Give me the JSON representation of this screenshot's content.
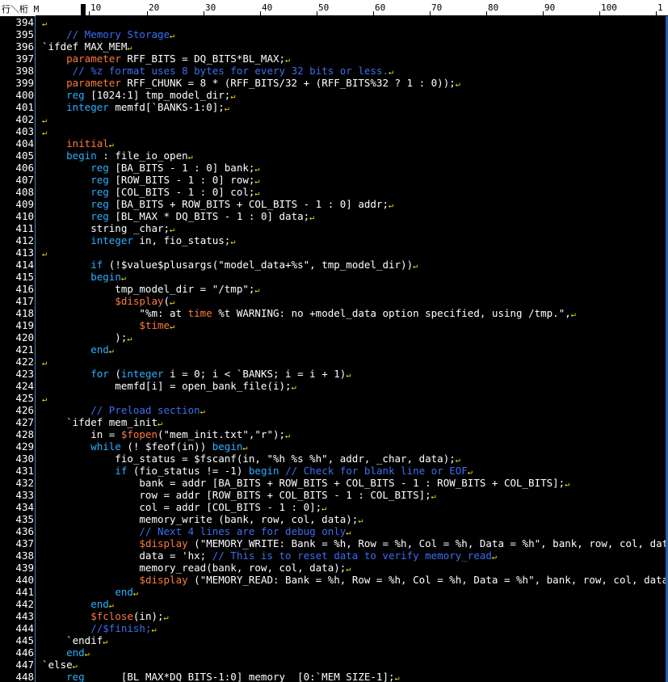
{
  "ruler": {
    "corner_label": "行＼桁 M",
    "marks": [
      "10",
      "20",
      "30",
      "40",
      "50",
      "60",
      "70",
      "80",
      "90",
      "100",
      "1"
    ]
  },
  "eol_glyph": "↵",
  "colors": {
    "keyword": "#2ab0ff",
    "system": "#ff7a3c",
    "comment": "#3a6ff0",
    "text": "#ffffff",
    "eol": "#ffe100"
  },
  "lines": [
    {
      "n": "394",
      "t": []
    },
    {
      "n": "395",
      "t": [
        [
          "    ",
          ""
        ],
        [
          "// Memory Storage",
          "cm"
        ]
      ]
    },
    {
      "n": "396",
      "t": [
        [
          "`ifdef MAX_MEM",
          ""
        ]
      ]
    },
    {
      "n": "397",
      "t": [
        [
          "    ",
          ""
        ],
        [
          "parameter",
          "pk"
        ],
        [
          " RFF_BITS = DQ_BITS*BL_MAX;",
          ""
        ]
      ]
    },
    {
      "n": "398",
      "t": [
        [
          "     ",
          ""
        ],
        [
          "// %z format uses 8 bytes for every 32 bits or less.",
          "cm"
        ]
      ]
    },
    {
      "n": "399",
      "t": [
        [
          "    ",
          ""
        ],
        [
          "parameter",
          "pk"
        ],
        [
          " RFF_CHUNK = 8 * (RFF_BITS/32 + (RFF_BITS%32 ? 1 : 0));",
          ""
        ]
      ]
    },
    {
      "n": "400",
      "t": [
        [
          "    ",
          ""
        ],
        [
          "reg",
          "kw"
        ],
        [
          " [1024:1] tmp_model_dir;",
          ""
        ]
      ]
    },
    {
      "n": "401",
      "t": [
        [
          "    ",
          ""
        ],
        [
          "integer",
          "kw"
        ],
        [
          " memfd[`BANKS-1:0];",
          ""
        ]
      ]
    },
    {
      "n": "402",
      "t": []
    },
    {
      "n": "403",
      "t": []
    },
    {
      "n": "404",
      "t": [
        [
          "    ",
          ""
        ],
        [
          "initial",
          "pk"
        ]
      ]
    },
    {
      "n": "405",
      "t": [
        [
          "    ",
          ""
        ],
        [
          "begin",
          "kw"
        ],
        [
          " : file_io_open",
          ""
        ]
      ]
    },
    {
      "n": "406",
      "t": [
        [
          "        ",
          ""
        ],
        [
          "reg",
          "kw"
        ],
        [
          " [BA_BITS - 1 : 0] bank;",
          ""
        ]
      ]
    },
    {
      "n": "407",
      "t": [
        [
          "        ",
          ""
        ],
        [
          "reg",
          "kw"
        ],
        [
          " [ROW_BITS - 1 : 0] row;",
          ""
        ]
      ]
    },
    {
      "n": "408",
      "t": [
        [
          "        ",
          ""
        ],
        [
          "reg",
          "kw"
        ],
        [
          " [COL_BITS - 1 : 0] col;",
          ""
        ]
      ]
    },
    {
      "n": "409",
      "t": [
        [
          "        ",
          ""
        ],
        [
          "reg",
          "kw"
        ],
        [
          " [BA_BITS + ROW_BITS + COL_BITS - 1 : 0] addr;",
          ""
        ]
      ]
    },
    {
      "n": "410",
      "t": [
        [
          "        ",
          ""
        ],
        [
          "reg",
          "kw"
        ],
        [
          " [BL_MAX * DQ_BITS - 1 : 0] data;",
          ""
        ]
      ]
    },
    {
      "n": "411",
      "t": [
        [
          "        string _char;",
          ""
        ]
      ]
    },
    {
      "n": "412",
      "t": [
        [
          "        ",
          ""
        ],
        [
          "integer",
          "kw"
        ],
        [
          " in, fio_status;",
          ""
        ]
      ]
    },
    {
      "n": "413",
      "t": []
    },
    {
      "n": "414",
      "t": [
        [
          "        ",
          ""
        ],
        [
          "if",
          "kw"
        ],
        [
          " (!$value$plusargs(\"model_data+%s\", tmp_model_dir))",
          ""
        ]
      ]
    },
    {
      "n": "415",
      "t": [
        [
          "        ",
          ""
        ],
        [
          "begin",
          "kw"
        ]
      ]
    },
    {
      "n": "416",
      "t": [
        [
          "            tmp_model_dir = \"/tmp\";",
          ""
        ]
      ]
    },
    {
      "n": "417",
      "t": [
        [
          "            ",
          ""
        ],
        [
          "$display",
          "pk"
        ],
        [
          "(",
          ""
        ]
      ]
    },
    {
      "n": "418",
      "t": [
        [
          "                \"%m: at ",
          ""
        ],
        [
          "time",
          "pk"
        ],
        [
          " %t WARNING: no +model_data option specified, using /tmp.\",",
          ""
        ]
      ]
    },
    {
      "n": "419",
      "t": [
        [
          "                ",
          ""
        ],
        [
          "$time",
          "pk"
        ]
      ]
    },
    {
      "n": "420",
      "t": [
        [
          "            );",
          ""
        ]
      ]
    },
    {
      "n": "421",
      "t": [
        [
          "        ",
          ""
        ],
        [
          "end",
          "kw"
        ]
      ]
    },
    {
      "n": "422",
      "t": []
    },
    {
      "n": "423",
      "t": [
        [
          "        ",
          ""
        ],
        [
          "for",
          "kw"
        ],
        [
          " (",
          ""
        ],
        [
          "integer",
          "kw"
        ],
        [
          " i = 0; i < `BANKS; i = i + 1)",
          ""
        ]
      ]
    },
    {
      "n": "424",
      "t": [
        [
          "            memfd[i] = open_bank_file(i);",
          ""
        ]
      ]
    },
    {
      "n": "425",
      "t": []
    },
    {
      "n": "426",
      "t": [
        [
          "        ",
          ""
        ],
        [
          "// Preload section",
          "cm"
        ]
      ]
    },
    {
      "n": "427",
      "t": [
        [
          "    `ifdef mem_init",
          ""
        ]
      ]
    },
    {
      "n": "428",
      "t": [
        [
          "        in = ",
          ""
        ],
        [
          "$fopen",
          "pk"
        ],
        [
          "(\"mem_init.txt\",\"r\");",
          ""
        ]
      ]
    },
    {
      "n": "429",
      "t": [
        [
          "        ",
          ""
        ],
        [
          "while",
          "kw"
        ],
        [
          " (! $feof(in)) ",
          ""
        ],
        [
          "begin",
          "kw"
        ]
      ]
    },
    {
      "n": "430",
      "t": [
        [
          "            fio_status = $fscanf(in, \"%h %s %h\", addr, _char, data);",
          ""
        ]
      ]
    },
    {
      "n": "431",
      "t": [
        [
          "            ",
          ""
        ],
        [
          "if",
          "kw"
        ],
        [
          " (fio_status != -1) ",
          ""
        ],
        [
          "begin",
          "kw"
        ],
        [
          " ",
          ""
        ],
        [
          "// Check for blank line or EOF",
          "cm"
        ]
      ]
    },
    {
      "n": "432",
      "t": [
        [
          "                bank = addr [BA_BITS + ROW_BITS + COL_BITS - 1 : ROW_BITS + COL_BITS];",
          ""
        ]
      ]
    },
    {
      "n": "433",
      "t": [
        [
          "                row = addr [ROW_BITS + COL_BITS - 1 : COL_BITS];",
          ""
        ]
      ]
    },
    {
      "n": "434",
      "t": [
        [
          "                col = addr [COL_BITS - 1 : 0];",
          ""
        ]
      ]
    },
    {
      "n": "435",
      "t": [
        [
          "                memory_write (bank, row, col, data);",
          ""
        ]
      ]
    },
    {
      "n": "436",
      "t": [
        [
          "                ",
          ""
        ],
        [
          "// Next 4 lines are for debug only",
          "cm"
        ]
      ]
    },
    {
      "n": "437",
      "t": [
        [
          "                ",
          ""
        ],
        [
          "$display",
          "pk"
        ],
        [
          " (\"MEMORY_WRITE: Bank = %h, Row = %h, Col = %h, Data = %h\", bank, row, col, data);",
          ""
        ]
      ]
    },
    {
      "n": "438",
      "t": [
        [
          "                data = 'hx; ",
          ""
        ],
        [
          "// This is to reset data to verify memory_read",
          "cm"
        ]
      ]
    },
    {
      "n": "439",
      "t": [
        [
          "                memory_read(bank, row, col, data);",
          ""
        ]
      ]
    },
    {
      "n": "440",
      "t": [
        [
          "                ",
          ""
        ],
        [
          "$display",
          "pk"
        ],
        [
          " (\"MEMORY_READ: Bank = %h, Row = %h, Col = %h, Data = %h\", bank, row, col, data);",
          ""
        ]
      ]
    },
    {
      "n": "441",
      "t": [
        [
          "            ",
          ""
        ],
        [
          "end",
          "kw"
        ]
      ]
    },
    {
      "n": "442",
      "t": [
        [
          "        ",
          ""
        ],
        [
          "end",
          "kw"
        ]
      ]
    },
    {
      "n": "443",
      "t": [
        [
          "        ",
          ""
        ],
        [
          "$fclose",
          "pk"
        ],
        [
          "(in);",
          ""
        ]
      ]
    },
    {
      "n": "444",
      "t": [
        [
          "        ",
          ""
        ],
        [
          "//$finish;",
          "cm"
        ]
      ]
    },
    {
      "n": "445",
      "t": [
        [
          "    `endif",
          ""
        ]
      ]
    },
    {
      "n": "446",
      "t": [
        [
          "    ",
          ""
        ],
        [
          "end",
          "kw"
        ]
      ]
    },
    {
      "n": "447",
      "t": [
        [
          "`else",
          ""
        ]
      ]
    },
    {
      "n": "448",
      "t": [
        [
          "    ",
          ""
        ],
        [
          "reg",
          "kw"
        ],
        [
          "      [BL_MAX*DQ_BITS-1:0] memory  [0:`MEM_SIZE-1];",
          ""
        ]
      ]
    }
  ]
}
